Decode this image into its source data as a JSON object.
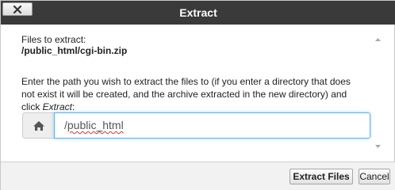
{
  "dialog": {
    "title": "Extract"
  },
  "content": {
    "files_label": "Files to extract:",
    "files_path": "/public_html/cgi-bin.zip",
    "instruction_before": "Enter the path you wish to extract the files to (if you enter a directory that does not exist it will be created, and the archive extracted in the new directory) and click ",
    "instruction_action": "Extract",
    "instruction_after": ":",
    "path_value_prefix": "/",
    "path_value_spell": "public_html"
  },
  "footer": {
    "extract_label": "Extract Files",
    "cancel_label": "Cancel"
  },
  "icons": {
    "close": "close-icon",
    "home": "home-icon",
    "scroll_up": "scroll-up-icon",
    "scroll_down": "scroll-down-icon"
  },
  "colors": {
    "titlebar": "#3a3a3a",
    "input_focus": "#66afe9",
    "footer": "#f2f2f2"
  }
}
